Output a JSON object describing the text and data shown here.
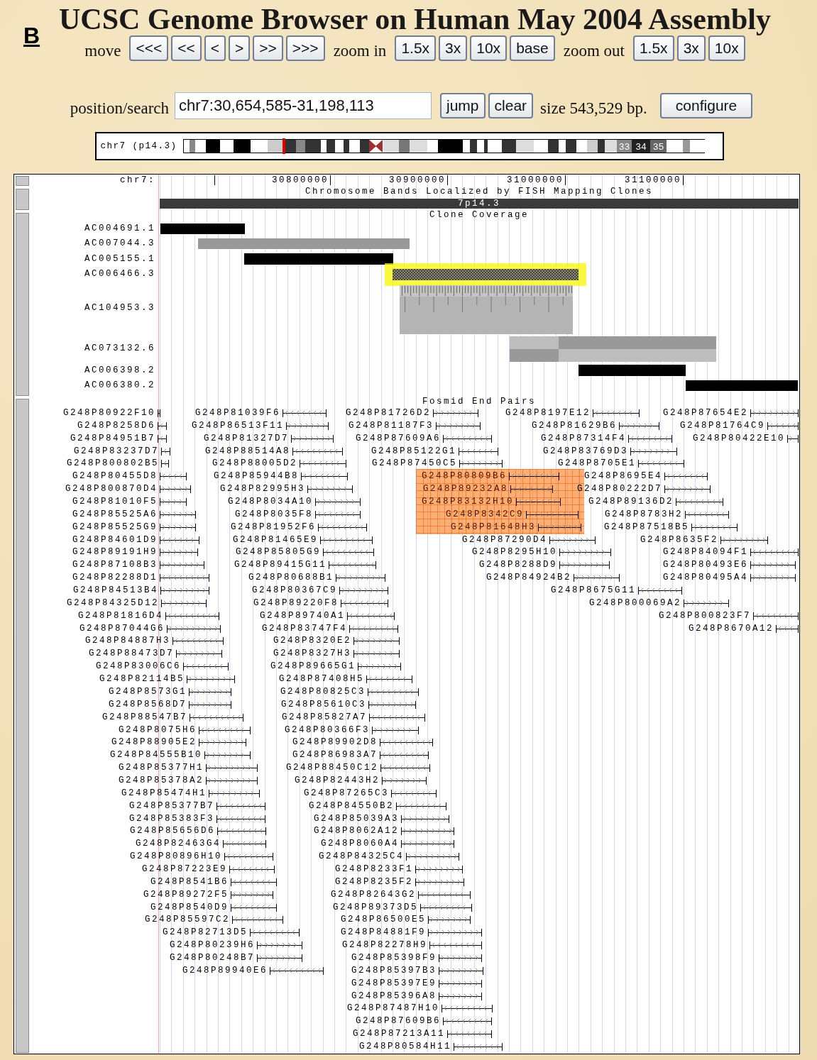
{
  "figure_label": "B",
  "title": "UCSC Genome Browser on Human May 2004 Assembly",
  "navigation": {
    "move_label": "move",
    "move_buttons": [
      "<<<",
      "<<",
      "<",
      ">",
      ">>",
      ">>>"
    ],
    "zoom_in_label": "zoom in",
    "zoom_in_buttons": [
      "1.5x",
      "3x",
      "10x",
      "base"
    ],
    "zoom_out_label": "zoom out",
    "zoom_out_buttons": [
      "1.5x",
      "3x",
      "10x"
    ]
  },
  "position": {
    "label": "position/search",
    "value": "chr7:30,654,585-31,198,113",
    "buttons": [
      "jump",
      "clear"
    ],
    "size_text": "size 543,529 bp.",
    "configure_button": "configure"
  },
  "ideogram": {
    "label": "chr7 (p14.3)",
    "band_labels": [
      "33",
      "34",
      "35"
    ]
  },
  "ruler": {
    "label": "chr7:",
    "ticks": [
      "30800000",
      "30900000",
      "31000000",
      "31100000"
    ]
  },
  "band_track": {
    "title": "Chromosome Bands Localized by FISH Mapping Clones",
    "band": "7p14.3"
  },
  "clone_track": {
    "title": "Clone Coverage",
    "clones": [
      {
        "name": "AC004691.1",
        "kind": "solid",
        "color": "#000000",
        "highlighted": false
      },
      {
        "name": "AC007044.3",
        "kind": "solid",
        "color": "#999999",
        "highlighted": false
      },
      {
        "name": "AC005155.1",
        "kind": "solid",
        "color": "#000000",
        "highlighted": false
      },
      {
        "name": "AC006466.3",
        "kind": "hatched",
        "color": "#444444",
        "highlighted": true
      },
      {
        "name": "AC104953.3",
        "kind": "fragmented",
        "color": "#b4b4b4",
        "highlighted": false
      },
      {
        "name": "AC073132.6",
        "kind": "split",
        "color": "#999999",
        "highlighted": false
      },
      {
        "name": "AC006398.2",
        "kind": "solid",
        "color": "#000000",
        "highlighted": false
      },
      {
        "name": "AC006380.2",
        "kind": "solid",
        "color": "#000000",
        "highlighted": false
      }
    ]
  },
  "fosmid_track": {
    "title": "Fosmid End Pairs",
    "features": [
      {
        "name": "G248P80922F10",
        "reverse": true,
        "highlighted": false
      },
      {
        "name": "G248P81039F6",
        "reverse": true,
        "highlighted": false
      },
      {
        "name": "G248P81726D2",
        "reverse": false,
        "highlighted": false
      },
      {
        "name": "G248P8197E12",
        "reverse": true,
        "highlighted": false
      },
      {
        "name": "G248P87654E2",
        "reverse": false,
        "highlighted": false
      },
      {
        "name": "G248P8258D6",
        "reverse": true,
        "highlighted": false
      },
      {
        "name": "G248P86513F11",
        "reverse": false,
        "highlighted": false
      },
      {
        "name": "G248P81187F3",
        "reverse": false,
        "highlighted": false
      },
      {
        "name": "G248P81629B6",
        "reverse": false,
        "highlighted": false
      },
      {
        "name": "G248P81764C9",
        "reverse": true,
        "highlighted": false
      },
      {
        "name": "G248P84951B7",
        "reverse": true,
        "highlighted": false
      },
      {
        "name": "G248P81327D7",
        "reverse": false,
        "highlighted": false
      },
      {
        "name": "G248P87609A6",
        "reverse": true,
        "highlighted": false
      },
      {
        "name": "G248P87314F4",
        "reverse": true,
        "highlighted": false
      },
      {
        "name": "G248P80422E10",
        "reverse": false,
        "highlighted": false
      },
      {
        "name": "G248P83237D7",
        "reverse": true,
        "highlighted": false
      },
      {
        "name": "G248P88514A8",
        "reverse": true,
        "highlighted": false
      },
      {
        "name": "G248P85122G1",
        "reverse": true,
        "highlighted": false
      },
      {
        "name": "G248P83769D3",
        "reverse": false,
        "highlighted": false
      },
      {
        "name": "G248P800802B5",
        "reverse": true,
        "highlighted": false
      },
      {
        "name": "G248P88005D2",
        "reverse": true,
        "highlighted": false
      },
      {
        "name": "G248P87450C5",
        "reverse": false,
        "highlighted": false
      },
      {
        "name": "G248P8705E1",
        "reverse": true,
        "highlighted": false
      },
      {
        "name": "G248P80455D8",
        "reverse": true,
        "highlighted": false
      },
      {
        "name": "G248P85944B8",
        "reverse": true,
        "highlighted": false
      },
      {
        "name": "G248P80809B6",
        "reverse": true,
        "highlighted": true
      },
      {
        "name": "G248P8695E4",
        "reverse": true,
        "highlighted": false
      },
      {
        "name": "G248P800870D4",
        "reverse": false,
        "highlighted": false
      },
      {
        "name": "G248P82995H3",
        "reverse": false,
        "highlighted": false
      },
      {
        "name": "G248P89232A8",
        "reverse": true,
        "highlighted": true
      },
      {
        "name": "G248P80222D7",
        "reverse": false,
        "highlighted": false
      },
      {
        "name": "G248P81010F5",
        "reverse": false,
        "highlighted": false
      },
      {
        "name": "G248P8034A10",
        "reverse": false,
        "highlighted": false
      },
      {
        "name": "G248P83132H10",
        "reverse": true,
        "highlighted": true
      },
      {
        "name": "G248P89136D2",
        "reverse": true,
        "highlighted": false
      },
      {
        "name": "G248P85525A6",
        "reverse": false,
        "highlighted": false
      },
      {
        "name": "G248P8035F8",
        "reverse": true,
        "highlighted": false
      },
      {
        "name": "G248P8342C9",
        "reverse": true,
        "highlighted": true
      },
      {
        "name": "G248P8783H2",
        "reverse": true,
        "highlighted": false
      },
      {
        "name": "G248P85525G9",
        "reverse": false,
        "highlighted": false
      },
      {
        "name": "G248P81952F6",
        "reverse": true,
        "highlighted": false
      },
      {
        "name": "G248P81648H3",
        "reverse": false,
        "highlighted": true
      },
      {
        "name": "G248P87518B5",
        "reverse": true,
        "highlighted": false
      },
      {
        "name": "G248P84601D9",
        "reverse": true,
        "highlighted": false
      },
      {
        "name": "G248P81465E9",
        "reverse": true,
        "highlighted": false
      },
      {
        "name": "G248P87290D4",
        "reverse": false,
        "highlighted": false
      },
      {
        "name": "G248P8635F2",
        "reverse": false,
        "highlighted": false
      },
      {
        "name": "G248P89191H9",
        "reverse": false,
        "highlighted": false
      },
      {
        "name": "G248P85805G9",
        "reverse": true,
        "highlighted": false
      },
      {
        "name": "G248P8295H10",
        "reverse": false,
        "highlighted": false
      },
      {
        "name": "G248P84094F1",
        "reverse": true,
        "highlighted": false
      },
      {
        "name": "G248P87108B3",
        "reverse": false,
        "highlighted": false
      },
      {
        "name": "G248P89415G11",
        "reverse": true,
        "highlighted": false
      },
      {
        "name": "G248P8288D9",
        "reverse": false,
        "highlighted": false
      },
      {
        "name": "G248P80493E6",
        "reverse": false,
        "highlighted": false
      },
      {
        "name": "G248P82288D1",
        "reverse": true,
        "highlighted": false
      },
      {
        "name": "G248P80688B1",
        "reverse": false,
        "highlighted": false
      },
      {
        "name": "G248P84924B2",
        "reverse": false,
        "highlighted": false
      },
      {
        "name": "G248P80495A4",
        "reverse": false,
        "highlighted": false
      },
      {
        "name": "G248P84513B4",
        "reverse": false,
        "highlighted": false
      },
      {
        "name": "G248P80367C9",
        "reverse": false,
        "highlighted": false
      },
      {
        "name": "G248P8675G11",
        "reverse": true,
        "highlighted": false
      },
      {
        "name": "G248P84325D12",
        "reverse": false,
        "highlighted": false
      },
      {
        "name": "G248P89220F8",
        "reverse": true,
        "highlighted": false
      },
      {
        "name": "G248P800069A2",
        "reverse": false,
        "highlighted": false
      },
      {
        "name": "G248P81816D4",
        "reverse": true,
        "highlighted": false
      },
      {
        "name": "G248P89740A1",
        "reverse": true,
        "highlighted": false
      },
      {
        "name": "G248P800823F7",
        "reverse": true,
        "highlighted": false
      },
      {
        "name": "G248P87044G6",
        "reverse": false,
        "highlighted": false
      },
      {
        "name": "G248P83747F4",
        "reverse": true,
        "highlighted": false
      },
      {
        "name": "G248P8670A12",
        "reverse": true,
        "highlighted": false
      },
      {
        "name": "G248P84887H3",
        "reverse": true,
        "highlighted": false
      },
      {
        "name": "G248P8320E2",
        "reverse": false,
        "highlighted": false
      },
      {
        "name": "G248P88473D7",
        "reverse": false,
        "highlighted": false
      },
      {
        "name": "G248P8327H3",
        "reverse": false,
        "highlighted": false
      },
      {
        "name": "G248P83006C6",
        "reverse": true,
        "highlighted": false
      },
      {
        "name": "G248P89665G1",
        "reverse": false,
        "highlighted": false
      },
      {
        "name": "G248P82114B5",
        "reverse": false,
        "highlighted": false
      },
      {
        "name": "G248P87408H5",
        "reverse": true,
        "highlighted": false
      },
      {
        "name": "G248P8573G1",
        "reverse": false,
        "highlighted": false
      },
      {
        "name": "G248P80825C3",
        "reverse": true,
        "highlighted": false
      },
      {
        "name": "G248P8568D7",
        "reverse": false,
        "highlighted": false
      },
      {
        "name": "G248P85610C3",
        "reverse": false,
        "highlighted": false
      },
      {
        "name": "G248P88547B7",
        "reverse": true,
        "highlighted": false
      },
      {
        "name": "G248P85827A7",
        "reverse": true,
        "highlighted": false
      },
      {
        "name": "G248P8075H6",
        "reverse": true,
        "highlighted": false
      },
      {
        "name": "G248P80366F3",
        "reverse": false,
        "highlighted": false
      },
      {
        "name": "G248P88905E2",
        "reverse": false,
        "highlighted": false
      },
      {
        "name": "G248P89902D8",
        "reverse": true,
        "highlighted": false
      },
      {
        "name": "G248P84555B10",
        "reverse": false,
        "highlighted": false
      },
      {
        "name": "G248P86983A7",
        "reverse": true,
        "highlighted": false
      },
      {
        "name": "G248P85377H1",
        "reverse": false,
        "highlighted": false
      },
      {
        "name": "G248P88450C12",
        "reverse": true,
        "highlighted": false
      },
      {
        "name": "G248P85378A2",
        "reverse": false,
        "highlighted": false
      },
      {
        "name": "G248P82443H2",
        "reverse": false,
        "highlighted": false
      },
      {
        "name": "G248P85474H1",
        "reverse": false,
        "highlighted": false
      },
      {
        "name": "G248P87265C3",
        "reverse": true,
        "highlighted": false
      },
      {
        "name": "G248P85377B7",
        "reverse": true,
        "highlighted": false
      },
      {
        "name": "G248P84550B2",
        "reverse": true,
        "highlighted": false
      },
      {
        "name": "G248P85383F3",
        "reverse": true,
        "highlighted": false
      },
      {
        "name": "G248P85039A3",
        "reverse": false,
        "highlighted": false
      },
      {
        "name": "G248P85656D6",
        "reverse": true,
        "highlighted": false
      },
      {
        "name": "G248P8062A12",
        "reverse": false,
        "highlighted": false
      },
      {
        "name": "G248P82463G4",
        "reverse": true,
        "highlighted": false
      },
      {
        "name": "G248P8060A4",
        "reverse": false,
        "highlighted": false
      },
      {
        "name": "G248P80896H10",
        "reverse": true,
        "highlighted": false
      },
      {
        "name": "G248P84325C4",
        "reverse": false,
        "highlighted": false
      },
      {
        "name": "G248P87223E9",
        "reverse": true,
        "highlighted": false
      },
      {
        "name": "G248P8233F1",
        "reverse": false,
        "highlighted": false
      },
      {
        "name": "G248P8541B6",
        "reverse": true,
        "highlighted": false
      },
      {
        "name": "G248P8235F2",
        "reverse": false,
        "highlighted": false
      },
      {
        "name": "G248P89272F5",
        "reverse": false,
        "highlighted": false
      },
      {
        "name": "G248P82643G2",
        "reverse": true,
        "highlighted": false
      },
      {
        "name": "G248P8540D9",
        "reverse": true,
        "highlighted": false
      },
      {
        "name": "G248P89373D5",
        "reverse": true,
        "highlighted": false
      },
      {
        "name": "G248P85597C2",
        "reverse": true,
        "highlighted": false
      },
      {
        "name": "G248P86500E5",
        "reverse": false,
        "highlighted": false
      },
      {
        "name": "G248P82713D5",
        "reverse": true,
        "highlighted": false
      },
      {
        "name": "G248P84881F9",
        "reverse": false,
        "highlighted": false
      },
      {
        "name": "G248P80239H6",
        "reverse": false,
        "highlighted": false
      },
      {
        "name": "G248P82278H9",
        "reverse": true,
        "highlighted": false
      },
      {
        "name": "G248P80248B7",
        "reverse": false,
        "highlighted": false
      },
      {
        "name": "G248P85398F9",
        "reverse": false,
        "highlighted": false
      },
      {
        "name": "G248P89940E6",
        "reverse": true,
        "highlighted": false
      },
      {
        "name": "G248P85397B3",
        "reverse": false,
        "highlighted": false
      },
      {
        "name": "G248P85397E9",
        "reverse": false,
        "highlighted": false
      },
      {
        "name": "G248P85396A8",
        "reverse": false,
        "highlighted": false
      },
      {
        "name": "G248P87487H10",
        "reverse": true,
        "highlighted": false
      },
      {
        "name": "G248P87609B6",
        "reverse": true,
        "highlighted": false
      },
      {
        "name": "G248P87213A11",
        "reverse": true,
        "highlighted": false
      },
      {
        "name": "G248P80584H11",
        "reverse": true,
        "highlighted": false
      }
    ]
  }
}
